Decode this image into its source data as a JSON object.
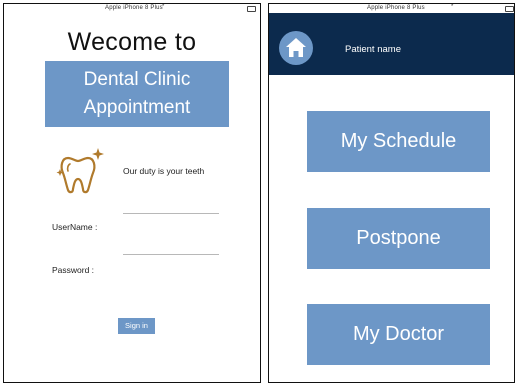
{
  "login_screen": {
    "status_bar": {
      "device": "Apple iPhone 8 Plus",
      "signal_mark": "*"
    },
    "title": "Wecome to",
    "banner": {
      "line1": "Dental Clinic",
      "line2": "Appointment"
    },
    "tagline": "Our duty is your teeth",
    "logo_icon": "tooth-sparkle-icon",
    "username_label": "UserName :",
    "password_label": "Password :",
    "sign_in_label": "Sign in"
  },
  "home_screen": {
    "status_bar": {
      "device": "Apple iPhone 8 Plus",
      "signal_mark": "*"
    },
    "home_icon": "home-icon",
    "patient_name": "Patient name",
    "menu": [
      {
        "label": "My Schedule"
      },
      {
        "label": "Postpone"
      },
      {
        "label": "My Doctor"
      }
    ]
  },
  "colors": {
    "accent": "#6d97c7",
    "header": "#0c2a4d",
    "logo": "#b07a2c"
  }
}
